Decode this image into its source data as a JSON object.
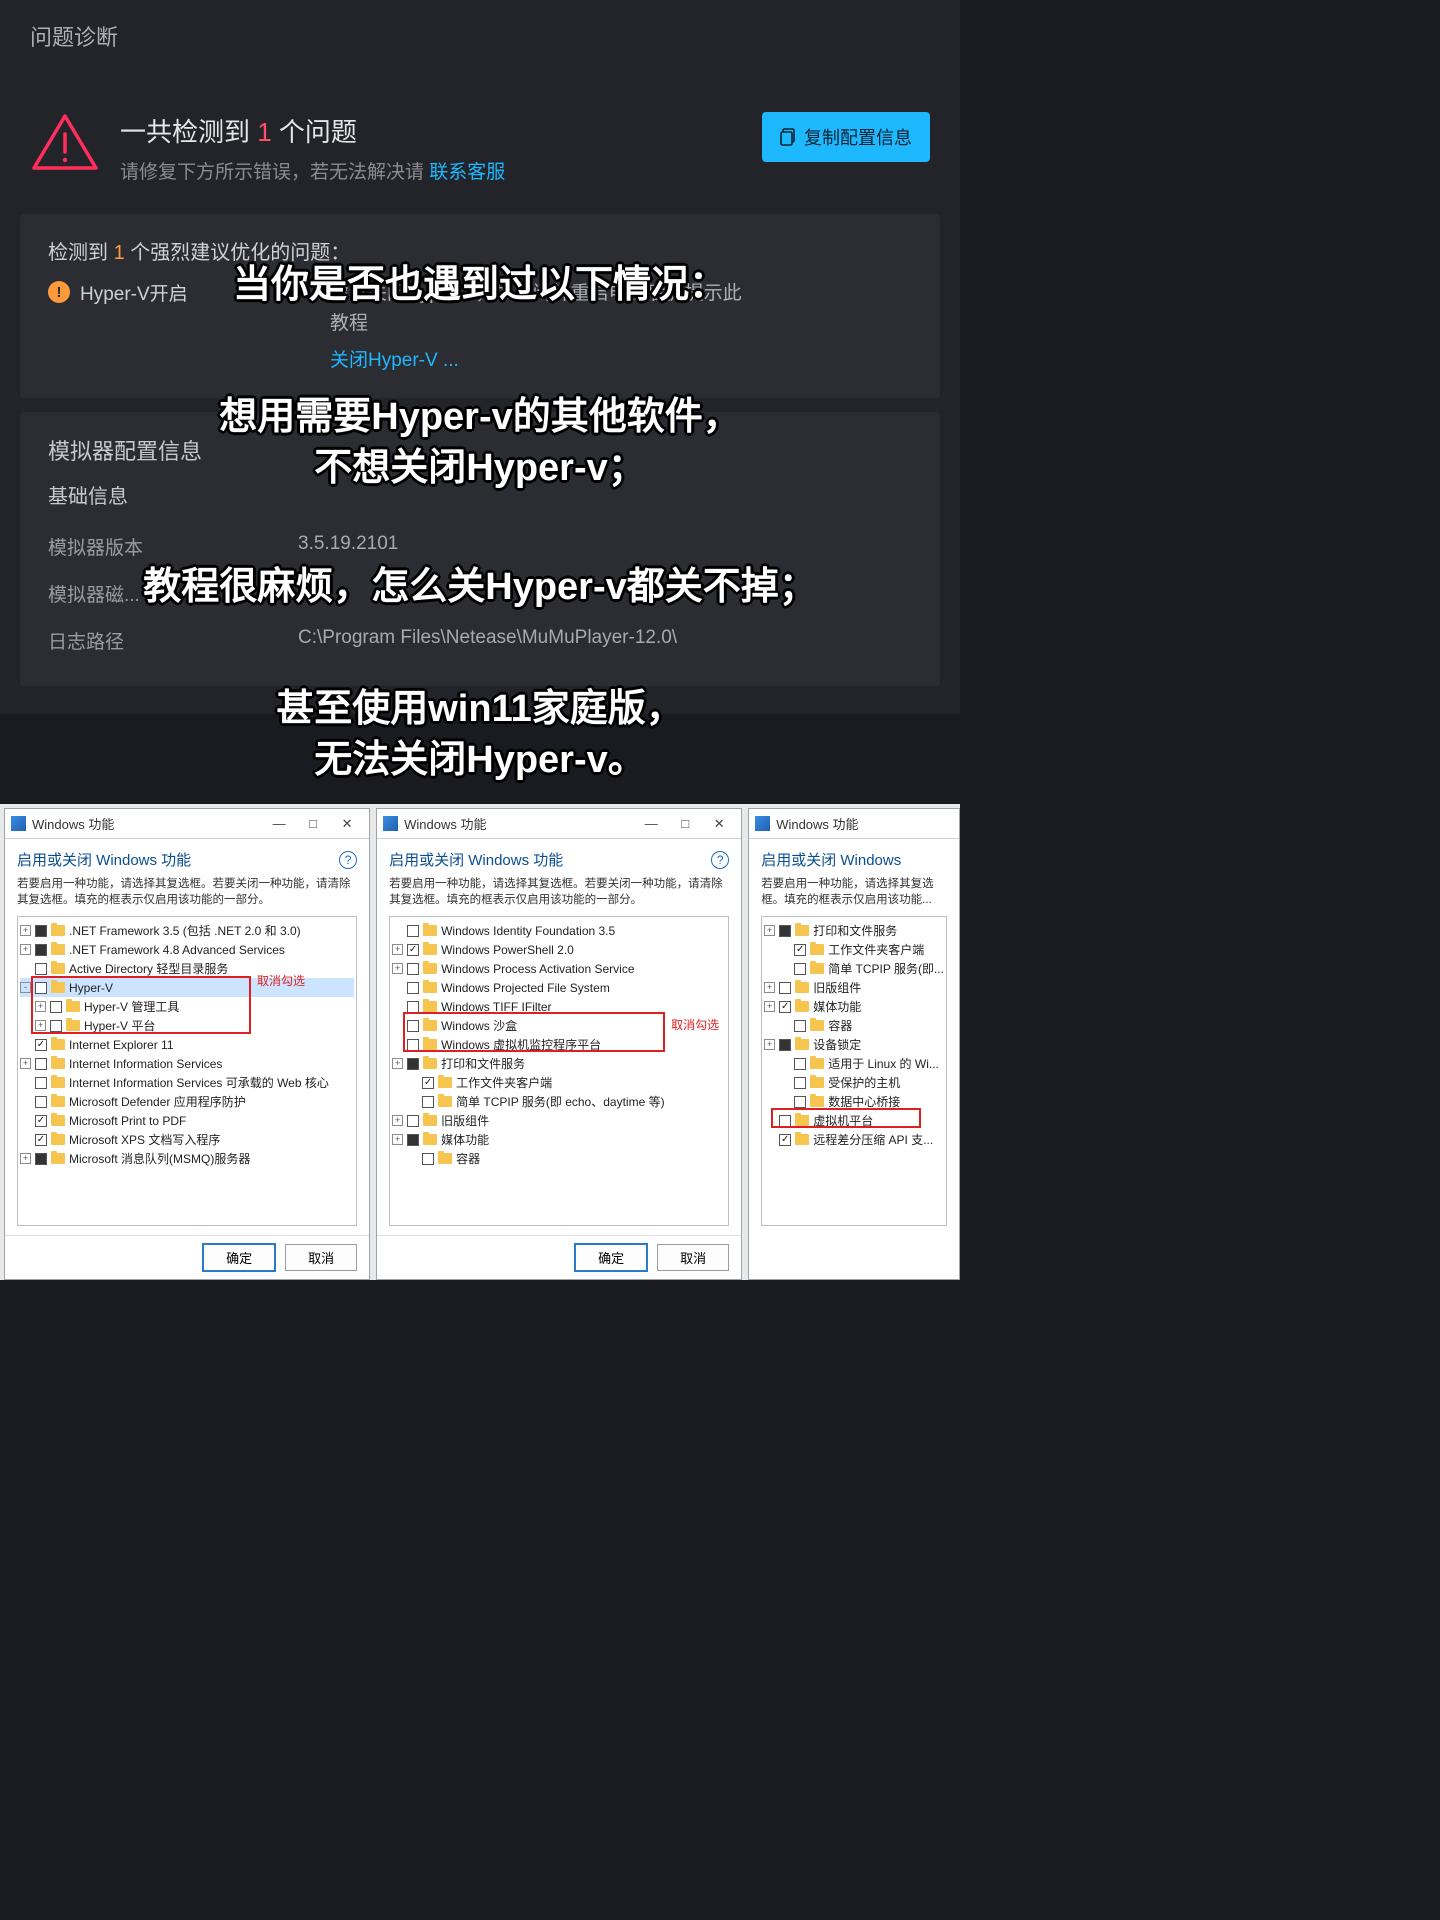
{
  "diagnosis": {
    "title": "问题诊断",
    "headline_prefix": "一共检测到 ",
    "headline_count": "1",
    "headline_suffix": " 个问题",
    "subline_prefix": "请修复下方所示错误，若无法解决请 ",
    "subline_link": "联系客服",
    "copy_button": "复制配置信息",
    "detected_prefix": "检测到 ",
    "detected_count": "1",
    "detected_suffix": " 个强烈建议优化的问题：",
    "issue_name": "Hyper-V开启",
    "issue_desc": "建议关闭Hyper-V，如关闭并重启电脑后仍提示此",
    "issue_desc2": "教程",
    "issue_link": "关闭Hyper-V ...",
    "config_title": "模拟器配置信息",
    "basic_title": "基础信息",
    "rows": [
      {
        "k": "模拟器版本",
        "v": "3.5.19.2101"
      },
      {
        "k": "模拟器磁...",
        "v": ""
      },
      {
        "k": "日志路径",
        "v": "C:\\Program Files\\Netease\\MuMuPlayer-12.0\\"
      }
    ]
  },
  "overlay": {
    "l1": "当你是否也遇到过以下情况：",
    "l2a": "想用需要Hyper-v的其他软件，",
    "l2b": "不想关闭Hyper-v；",
    "l3": "教程很麻烦，怎么关Hyper-v都关不掉；",
    "l4a": "甚至使用win11家庭版，",
    "l4b": "无法关闭Hyper-v。"
  },
  "winfeat": {
    "title": "Windows 功能",
    "heading": "启用或关闭 Windows 功能",
    "heading_short": "启用或关闭 Windows ",
    "desc": "若要启用一种功能，请选择其复选框。若要关闭一种功能，请清除其复选框。填充的框表示仅启用该功能的一部分。",
    "desc_short": "若要启用一种功能，请选择其复选框。填充的框表示仅启用该功能...",
    "ok": "确定",
    "cancel": "取消",
    "uncheck_note": "取消勾选",
    "tree1": [
      {
        "ind": 0,
        "exp": "+",
        "cb": "fill",
        "txt": ".NET Framework 3.5 (包括 .NET 2.0 和 3.0)"
      },
      {
        "ind": 0,
        "exp": "+",
        "cb": "fill",
        "txt": ".NET Framework 4.8 Advanced Services"
      },
      {
        "ind": 0,
        "exp": "",
        "cb": "",
        "txt": "Active Directory 轻型目录服务"
      },
      {
        "ind": 0,
        "exp": "-",
        "cb": "",
        "txt": "Hyper-V",
        "hi": true
      },
      {
        "ind": 1,
        "exp": "+",
        "cb": "",
        "txt": "Hyper-V 管理工具"
      },
      {
        "ind": 1,
        "exp": "+",
        "cb": "",
        "txt": "Hyper-V 平台"
      },
      {
        "ind": 0,
        "exp": "",
        "cb": "chk",
        "txt": "Internet Explorer 11"
      },
      {
        "ind": 0,
        "exp": "+",
        "cb": "",
        "txt": "Internet Information Services"
      },
      {
        "ind": 0,
        "exp": "",
        "cb": "",
        "txt": "Internet Information Services 可承载的 Web 核心"
      },
      {
        "ind": 0,
        "exp": "",
        "cb": "",
        "txt": "Microsoft Defender 应用程序防护"
      },
      {
        "ind": 0,
        "exp": "",
        "cb": "chk",
        "txt": "Microsoft Print to PDF"
      },
      {
        "ind": 0,
        "exp": "",
        "cb": "chk",
        "txt": "Microsoft XPS 文档写入程序"
      },
      {
        "ind": 0,
        "exp": "+",
        "cb": "fill",
        "txt": "Microsoft 消息队列(MSMQ)服务器"
      }
    ],
    "tree2": [
      {
        "ind": 0,
        "exp": "",
        "cb": "",
        "txt": "Windows Identity Foundation 3.5"
      },
      {
        "ind": 0,
        "exp": "+",
        "cb": "chk",
        "txt": "Windows PowerShell 2.0"
      },
      {
        "ind": 0,
        "exp": "+",
        "cb": "",
        "txt": "Windows Process Activation Service"
      },
      {
        "ind": 0,
        "exp": "",
        "cb": "",
        "txt": "Windows Projected File System"
      },
      {
        "ind": 0,
        "exp": "",
        "cb": "",
        "txt": "Windows TIFF IFilter"
      },
      {
        "ind": 0,
        "exp": "",
        "cb": "",
        "txt": "Windows 沙盒"
      },
      {
        "ind": 0,
        "exp": "",
        "cb": "",
        "txt": "Windows 虚拟机监控程序平台"
      },
      {
        "ind": 0,
        "exp": "+",
        "cb": "fill",
        "txt": "打印和文件服务"
      },
      {
        "ind": 1,
        "exp": "",
        "cb": "chk",
        "txt": "工作文件夹客户端"
      },
      {
        "ind": 1,
        "exp": "",
        "cb": "",
        "txt": "简单 TCPIP 服务(即 echo、daytime 等)"
      },
      {
        "ind": 0,
        "exp": "+",
        "cb": "",
        "txt": "旧版组件"
      },
      {
        "ind": 0,
        "exp": "+",
        "cb": "fill",
        "txt": "媒体功能"
      },
      {
        "ind": 1,
        "exp": "",
        "cb": "",
        "txt": "容器"
      }
    ],
    "tree3": [
      {
        "ind": 0,
        "exp": "+",
        "cb": "fill",
        "txt": "打印和文件服务"
      },
      {
        "ind": 1,
        "exp": "",
        "cb": "chk",
        "txt": "工作文件夹客户端"
      },
      {
        "ind": 1,
        "exp": "",
        "cb": "",
        "txt": "简单 TCPIP 服务(即..."
      },
      {
        "ind": 0,
        "exp": "+",
        "cb": "",
        "txt": "旧版组件"
      },
      {
        "ind": 0,
        "exp": "+",
        "cb": "chk",
        "txt": "媒体功能"
      },
      {
        "ind": 1,
        "exp": "",
        "cb": "",
        "txt": "容器"
      },
      {
        "ind": 0,
        "exp": "+",
        "cb": "fill",
        "txt": "设备锁定"
      },
      {
        "ind": 1,
        "exp": "",
        "cb": "",
        "txt": "适用于 Linux 的 Wi..."
      },
      {
        "ind": 1,
        "exp": "",
        "cb": "",
        "txt": "受保护的主机"
      },
      {
        "ind": 1,
        "exp": "",
        "cb": "",
        "txt": "数据中心桥接"
      },
      {
        "ind": 0,
        "exp": "",
        "cb": "",
        "txt": "虚拟机平台"
      },
      {
        "ind": 0,
        "exp": "",
        "cb": "chk",
        "txt": "远程差分压缩 API 支..."
      }
    ]
  }
}
